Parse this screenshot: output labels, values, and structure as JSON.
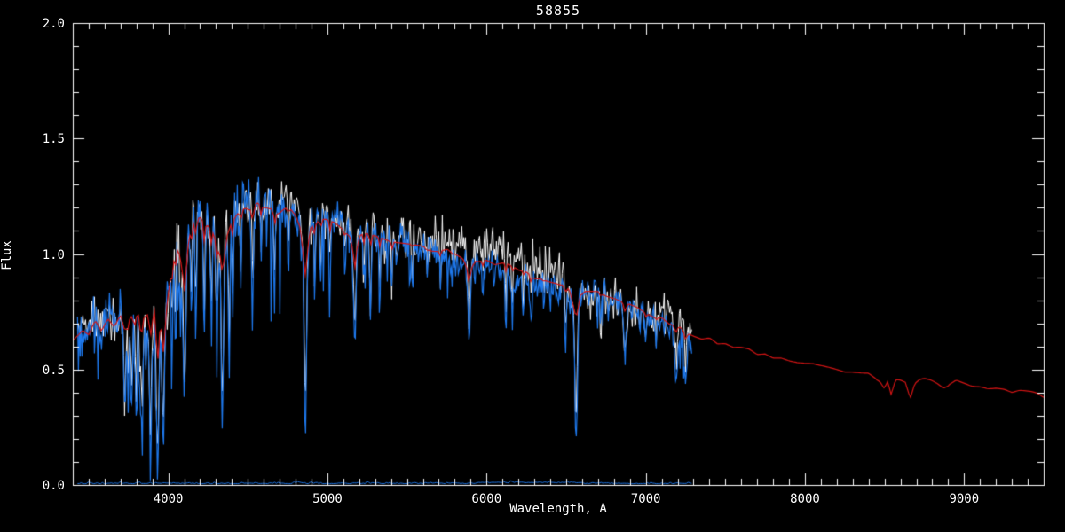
{
  "figure": {
    "background": "#000000",
    "axis_color": "#ffffff",
    "text_color": "#ffffff"
  },
  "chart_data": {
    "type": "line",
    "title": "58855",
    "xlabel": "Wavelength, A",
    "ylabel": "Flux",
    "xlim": [
      3400,
      9500
    ],
    "ylim": [
      0.0,
      2.0
    ],
    "grid": false,
    "legend": "none",
    "x_major_ticks": [
      4000,
      5000,
      6000,
      7000,
      8000,
      9000
    ],
    "x_tick_labels": [
      "4000",
      "5000",
      "6000",
      "7000",
      "8000",
      "9000"
    ],
    "x_minor_step": 100,
    "y_major_ticks": [
      0.0,
      0.5,
      1.0,
      1.5,
      2.0
    ],
    "y_tick_labels": [
      "0.0",
      "0.5",
      "1.0",
      "1.5",
      "2.0"
    ],
    "y_minor_step": 0.1,
    "series": [
      {
        "name": "observed-spectrum",
        "color": "#ffffff",
        "range": [
          3430,
          7290
        ],
        "style": "noisy-line"
      },
      {
        "name": "processed-spectrum",
        "color": "#1e79ee",
        "range": [
          3430,
          7290
        ],
        "style": "noisy-line-with-absorption"
      },
      {
        "name": "template-fit",
        "color": "#d41414",
        "range": [
          3400,
          9500
        ],
        "style": "smooth-line"
      },
      {
        "name": "error-spectrum",
        "color": "#1e79ee",
        "range": [
          3430,
          7290
        ],
        "style": "near-zero-line",
        "level": 0.006
      }
    ],
    "continuum": [
      [
        3400,
        0.62
      ],
      [
        3460,
        0.67
      ],
      [
        3500,
        0.64
      ],
      [
        3540,
        0.7
      ],
      [
        3580,
        0.66
      ],
      [
        3620,
        0.72
      ],
      [
        3660,
        0.69
      ],
      [
        3700,
        0.74
      ],
      [
        3730,
        0.66
      ],
      [
        3760,
        0.74
      ],
      [
        3790,
        0.7
      ],
      [
        3810,
        0.77
      ],
      [
        3835,
        0.66
      ],
      [
        3860,
        0.78
      ],
      [
        3890,
        0.64
      ],
      [
        3912,
        0.76
      ],
      [
        3933,
        0.52
      ],
      [
        3952,
        0.72
      ],
      [
        3970,
        0.56
      ],
      [
        3990,
        0.76
      ],
      [
        4020,
        0.92
      ],
      [
        4050,
        1.03
      ],
      [
        4080,
        1.0
      ],
      [
        4101,
        0.82
      ],
      [
        4130,
        1.08
      ],
      [
        4160,
        1.14
      ],
      [
        4200,
        1.16
      ],
      [
        4240,
        1.12
      ],
      [
        4280,
        1.1
      ],
      [
        4320,
        1.02
      ],
      [
        4340,
        0.92
      ],
      [
        4370,
        1.08
      ],
      [
        4400,
        1.14
      ],
      [
        4440,
        1.18
      ],
      [
        4480,
        1.2
      ],
      [
        4520,
        1.19
      ],
      [
        4560,
        1.22
      ],
      [
        4600,
        1.21
      ],
      [
        4640,
        1.19
      ],
      [
        4680,
        1.17
      ],
      [
        4720,
        1.19
      ],
      [
        4760,
        1.2
      ],
      [
        4800,
        1.17
      ],
      [
        4830,
        1.12
      ],
      [
        4861,
        0.92
      ],
      [
        4890,
        1.12
      ],
      [
        4920,
        1.14
      ],
      [
        4957,
        1.16
      ],
      [
        5000,
        1.15
      ],
      [
        5050,
        1.13
      ],
      [
        5100,
        1.11
      ],
      [
        5140,
        1.08
      ],
      [
        5172,
        1.0
      ],
      [
        5210,
        1.08
      ],
      [
        5250,
        1.09
      ],
      [
        5300,
        1.07
      ],
      [
        5350,
        1.06
      ],
      [
        5400,
        1.06
      ],
      [
        5450,
        1.05
      ],
      [
        5500,
        1.05
      ],
      [
        5550,
        1.04
      ],
      [
        5600,
        1.03
      ],
      [
        5650,
        1.02
      ],
      [
        5700,
        1.015
      ],
      [
        5750,
        1.01
      ],
      [
        5800,
        1.0
      ],
      [
        5850,
        0.985
      ],
      [
        5890,
        0.935
      ],
      [
        5930,
        0.98
      ],
      [
        5980,
        0.975
      ],
      [
        6030,
        0.97
      ],
      [
        6080,
        0.96
      ],
      [
        6130,
        0.95
      ],
      [
        6180,
        0.935
      ],
      [
        6230,
        0.92
      ],
      [
        6280,
        0.905
      ],
      [
        6330,
        0.895
      ],
      [
        6380,
        0.885
      ],
      [
        6440,
        0.875
      ],
      [
        6490,
        0.86
      ],
      [
        6520,
        0.84
      ],
      [
        6563,
        0.72
      ],
      [
        6590,
        0.83
      ],
      [
        6620,
        0.845
      ],
      [
        6660,
        0.84
      ],
      [
        6700,
        0.835
      ],
      [
        6750,
        0.825
      ],
      [
        6800,
        0.81
      ],
      [
        6850,
        0.79
      ],
      [
        6900,
        0.775
      ],
      [
        6950,
        0.765
      ],
      [
        7000,
        0.75
      ],
      [
        7050,
        0.735
      ],
      [
        7100,
        0.72
      ],
      [
        7150,
        0.7
      ],
      [
        7200,
        0.685
      ],
      [
        7250,
        0.665
      ],
      [
        7300,
        0.648
      ],
      [
        7350,
        0.638
      ],
      [
        7400,
        0.63
      ],
      [
        7450,
        0.62
      ],
      [
        7500,
        0.612
      ],
      [
        7550,
        0.605
      ],
      [
        7600,
        0.595
      ],
      [
        7650,
        0.585
      ],
      [
        7700,
        0.573
      ],
      [
        7750,
        0.562
      ],
      [
        7800,
        0.553
      ],
      [
        7850,
        0.547
      ],
      [
        7900,
        0.541
      ],
      [
        7950,
        0.537
      ],
      [
        8000,
        0.532
      ],
      [
        8050,
        0.524
      ],
      [
        8100,
        0.515
      ],
      [
        8150,
        0.505
      ],
      [
        8200,
        0.497
      ],
      [
        8250,
        0.492
      ],
      [
        8300,
        0.488
      ],
      [
        8350,
        0.482
      ],
      [
        8400,
        0.475
      ],
      [
        8440,
        0.468
      ],
      [
        8470,
        0.455
      ],
      [
        8498,
        0.425
      ],
      [
        8520,
        0.45
      ],
      [
        8542,
        0.385
      ],
      [
        8570,
        0.455
      ],
      [
        8600,
        0.46
      ],
      [
        8630,
        0.45
      ],
      [
        8662,
        0.378
      ],
      [
        8690,
        0.44
      ],
      [
        8720,
        0.455
      ],
      [
        8750,
        0.458
      ],
      [
        8790,
        0.452
      ],
      [
        8830,
        0.44
      ],
      [
        8870,
        0.423
      ],
      [
        8910,
        0.44
      ],
      [
        8950,
        0.443
      ],
      [
        9000,
        0.44
      ],
      [
        9060,
        0.435
      ],
      [
        9120,
        0.428
      ],
      [
        9180,
        0.42
      ],
      [
        9240,
        0.415
      ],
      [
        9300,
        0.41
      ],
      [
        9360,
        0.403
      ],
      [
        9420,
        0.396
      ],
      [
        9470,
        0.385
      ],
      [
        9500,
        0.375
      ]
    ],
    "absorption_lines": [
      [
        3727,
        0.45,
        6
      ],
      [
        3750,
        0.55,
        5
      ],
      [
        3771,
        0.45,
        5
      ],
      [
        3798,
        0.4,
        5
      ],
      [
        3820,
        0.55,
        5
      ],
      [
        3835,
        0.28,
        6
      ],
      [
        3860,
        0.55,
        5
      ],
      [
        3889,
        0.25,
        6
      ],
      [
        3933,
        0.15,
        7
      ],
      [
        3968,
        0.22,
        7
      ],
      [
        4026,
        0.65,
        4
      ],
      [
        4045,
        0.58,
        4
      ],
      [
        4077,
        0.65,
        4
      ],
      [
        4101,
        0.4,
        7
      ],
      [
        4144,
        0.65,
        4
      ],
      [
        4173,
        0.62,
        5
      ],
      [
        4226,
        0.52,
        5
      ],
      [
        4271,
        0.6,
        5
      ],
      [
        4305,
        0.58,
        6
      ],
      [
        4340,
        0.28,
        7
      ],
      [
        4383,
        0.45,
        5
      ],
      [
        4405,
        0.62,
        4
      ],
      [
        4455,
        0.68,
        4
      ],
      [
        4531,
        0.66,
        5
      ],
      [
        4584,
        0.74,
        4
      ],
      [
        4668,
        0.68,
        5
      ],
      [
        4755,
        0.76,
        4
      ],
      [
        4861,
        0.28,
        7
      ],
      [
        4920,
        0.68,
        4
      ],
      [
        4957,
        0.72,
        4
      ],
      [
        5015,
        0.7,
        4
      ],
      [
        5110,
        0.78,
        3
      ],
      [
        5172,
        0.58,
        7
      ],
      [
        5227,
        0.72,
        4
      ],
      [
        5270,
        0.66,
        5
      ],
      [
        5328,
        0.74,
        4
      ],
      [
        5405,
        0.78,
        4
      ],
      [
        5535,
        0.8,
        3
      ],
      [
        5625,
        0.82,
        3
      ],
      [
        5711,
        0.82,
        3
      ],
      [
        5782,
        0.85,
        3
      ],
      [
        5890,
        0.66,
        7
      ],
      [
        5975,
        0.85,
        3
      ],
      [
        6122,
        0.76,
        4
      ],
      [
        6162,
        0.8,
        4
      ],
      [
        6230,
        0.85,
        3
      ],
      [
        6280,
        0.76,
        4
      ],
      [
        6360,
        0.85,
        3
      ],
      [
        6495,
        0.74,
        5
      ],
      [
        6563,
        0.22,
        7
      ],
      [
        6717,
        0.82,
        4
      ],
      [
        6870,
        0.68,
        8
      ],
      [
        7000,
        0.85,
        4
      ],
      [
        7065,
        0.85,
        4
      ],
      [
        7190,
        0.68,
        9
      ],
      [
        7250,
        0.7,
        7
      ]
    ],
    "white_scale": [
      [
        3430,
        1.03
      ],
      [
        4700,
        1.03
      ],
      [
        4900,
        1.02
      ],
      [
        5500,
        1.01
      ],
      [
        5700,
        1.03
      ],
      [
        5900,
        1.06
      ],
      [
        6050,
        1.075
      ],
      [
        6250,
        1.07
      ],
      [
        6450,
        1.04
      ],
      [
        6570,
        1.0
      ],
      [
        6650,
        0.975
      ],
      [
        6950,
        0.97
      ],
      [
        7050,
        1.02
      ],
      [
        7150,
        1.08
      ],
      [
        7220,
        1.1
      ],
      [
        7290,
        1.02
      ]
    ],
    "blue_scale": [
      [
        3430,
        1.02
      ],
      [
        4700,
        1.02
      ],
      [
        4900,
        1.01
      ],
      [
        5600,
        1.0
      ],
      [
        5800,
        0.985
      ],
      [
        5950,
        0.97
      ],
      [
        6150,
        0.96
      ],
      [
        6400,
        0.965
      ],
      [
        6520,
        0.99
      ],
      [
        6620,
        1.005
      ],
      [
        6900,
        0.995
      ],
      [
        7050,
        0.975
      ],
      [
        7200,
        0.96
      ],
      [
        7290,
        0.93
      ]
    ],
    "white_noise": [
      [
        3430,
        0.05
      ],
      [
        4800,
        0.05
      ],
      [
        5200,
        0.045
      ],
      [
        5800,
        0.05
      ],
      [
        6500,
        0.045
      ],
      [
        7290,
        0.04
      ]
    ],
    "blue_noise": [
      [
        3430,
        0.055
      ],
      [
        4700,
        0.05
      ],
      [
        4900,
        0.04
      ],
      [
        5600,
        0.035
      ],
      [
        7290,
        0.03
      ]
    ],
    "blue_spikes": {
      "blue_end_wavelength": 4800,
      "p_early": 0.17,
      "amp_early": 0.55,
      "p_late": 0.09,
      "amp_late": 0.3
    },
    "red_wiggle_amplitude": 0.006,
    "error_level": 0.005
  }
}
